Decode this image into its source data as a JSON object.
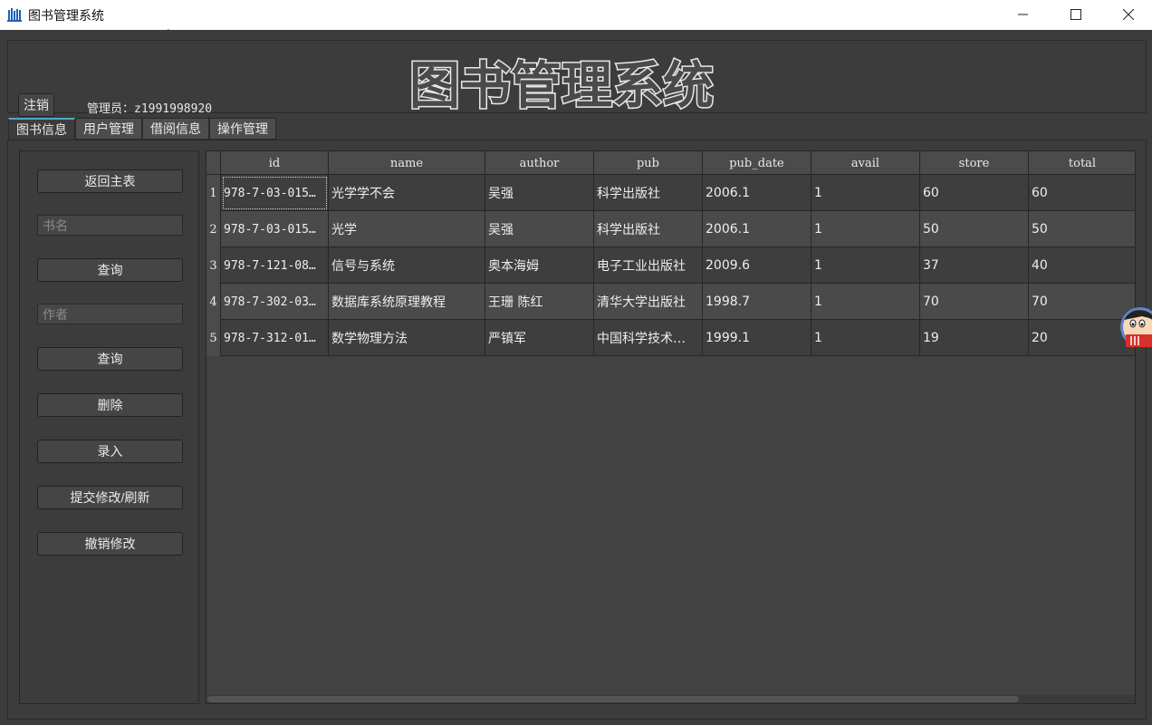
{
  "window": {
    "title": "图书管理系统",
    "controls": {
      "minimize": "minimize-icon",
      "maximize": "maximize-icon",
      "close": "close-icon"
    }
  },
  "header": {
    "logo_text": "图书管理系统",
    "logout_label": "注销",
    "admin_label": "管理员：z1991998920"
  },
  "tabs": [
    {
      "label": "图书信息",
      "active": true
    },
    {
      "label": "用户管理",
      "active": false
    },
    {
      "label": "借阅信息",
      "active": false
    },
    {
      "label": "操作管理",
      "active": false
    }
  ],
  "left_panel": {
    "back_label": "返回主表",
    "book_name_placeholder": "书名",
    "query_label_1": "查询",
    "author_placeholder": "作者",
    "query_label_2": "查询",
    "delete_label": "删除",
    "insert_label": "录入",
    "submit_label": "提交修改/刷新",
    "revert_label": "撤销修改"
  },
  "table": {
    "columns": [
      "id",
      "name",
      "author",
      "pub",
      "pub_date",
      "avail",
      "store",
      "total"
    ],
    "rows": [
      {
        "num": "1",
        "id": "978-7-03-015…",
        "name": "光学学不会",
        "author": "吴强",
        "pub": "科学出版社",
        "pub_date": "2006.1",
        "avail": "1",
        "store": "60",
        "total": "60"
      },
      {
        "num": "2",
        "id": "978-7-03-015…",
        "name": "光学",
        "author": "吴强",
        "pub": "科学出版社",
        "pub_date": "2006.1",
        "avail": "1",
        "store": "50",
        "total": "50"
      },
      {
        "num": "3",
        "id": "978-7-121-08…",
        "name": "信号与系统",
        "author": "奥本海姆",
        "pub": "电子工业出版社",
        "pub_date": "2009.6",
        "avail": "1",
        "store": "37",
        "total": "40"
      },
      {
        "num": "4",
        "id": "978-7-302-03…",
        "name": "数据库系统原理教程",
        "author": "王珊 陈红",
        "pub": "清华大学出版社",
        "pub_date": "1998.7",
        "avail": "1",
        "store": "70",
        "total": "70"
      },
      {
        "num": "5",
        "id": "978-7-312-01…",
        "name": "数学物理方法",
        "author": "严镇军",
        "pub": "中国科学技术…",
        "pub_date": "1999.1",
        "avail": "1",
        "store": "19",
        "total": "20"
      }
    ]
  },
  "colors": {
    "window_bg": "#3c3c3c",
    "tab_accent": "#4ea8c8",
    "app_icon": "#1f5fb8"
  }
}
